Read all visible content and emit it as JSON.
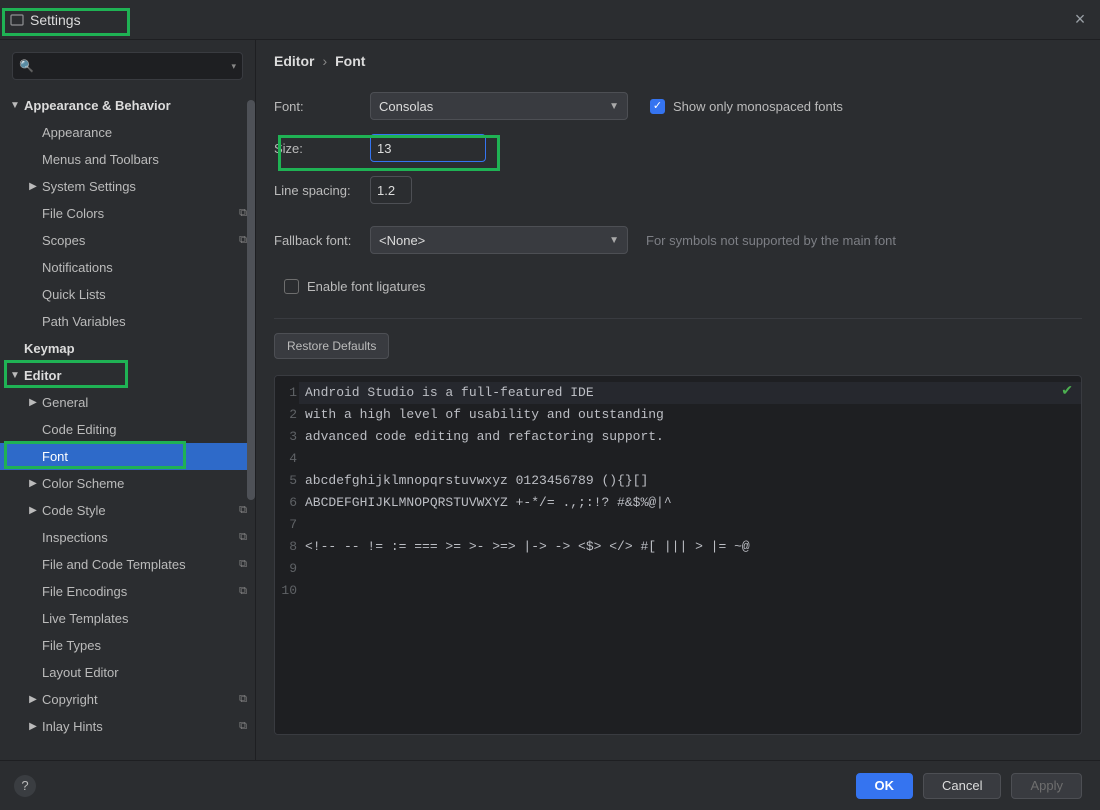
{
  "window": {
    "title": "Settings"
  },
  "search": {
    "placeholder": ""
  },
  "sidebar": {
    "items": [
      {
        "label": "Appearance & Behavior",
        "depth": 0,
        "bold": true,
        "arrow": "▼"
      },
      {
        "label": "Appearance",
        "depth": 1
      },
      {
        "label": "Menus and Toolbars",
        "depth": 1
      },
      {
        "label": "System Settings",
        "depth": 1,
        "arrow": "▶"
      },
      {
        "label": "File Colors",
        "depth": 1,
        "copy": true
      },
      {
        "label": "Scopes",
        "depth": 1,
        "copy": true
      },
      {
        "label": "Notifications",
        "depth": 1
      },
      {
        "label": "Quick Lists",
        "depth": 1
      },
      {
        "label": "Path Variables",
        "depth": 1
      },
      {
        "label": "Keymap",
        "depth": 0,
        "bold": true
      },
      {
        "label": "Editor",
        "depth": 0,
        "bold": true,
        "arrow": "▼"
      },
      {
        "label": "General",
        "depth": 1,
        "arrow": "▶"
      },
      {
        "label": "Code Editing",
        "depth": 1
      },
      {
        "label": "Font",
        "depth": 1,
        "selected": true
      },
      {
        "label": "Color Scheme",
        "depth": 1,
        "arrow": "▶"
      },
      {
        "label": "Code Style",
        "depth": 1,
        "arrow": "▶",
        "copy": true
      },
      {
        "label": "Inspections",
        "depth": 1,
        "copy": true
      },
      {
        "label": "File and Code Templates",
        "depth": 1,
        "copy": true
      },
      {
        "label": "File Encodings",
        "depth": 1,
        "copy": true
      },
      {
        "label": "Live Templates",
        "depth": 1
      },
      {
        "label": "File Types",
        "depth": 1
      },
      {
        "label": "Layout Editor",
        "depth": 1
      },
      {
        "label": "Copyright",
        "depth": 1,
        "arrow": "▶",
        "copy": true
      },
      {
        "label": "Inlay Hints",
        "depth": 1,
        "arrow": "▶",
        "copy": true
      }
    ]
  },
  "breadcrumb": {
    "parent": "Editor",
    "current": "Font"
  },
  "form": {
    "font_label": "Font:",
    "font_value": "Consolas",
    "show_monospaced_label": "Show only monospaced fonts",
    "show_monospaced_checked": true,
    "size_label": "Size:",
    "size_value": "13",
    "line_spacing_label": "Line spacing:",
    "line_spacing_value": "1.2",
    "fallback_label": "Fallback font:",
    "fallback_value": "<None>",
    "fallback_hint": "For symbols not supported by the main font",
    "ligatures_label": "Enable font ligatures",
    "ligatures_checked": false,
    "restore_label": "Restore Defaults"
  },
  "preview": {
    "lines": [
      "Android Studio is a full-featured IDE",
      "with a high level of usability and outstanding",
      "advanced code editing and refactoring support.",
      "",
      "abcdefghijklmnopqrstuvwxyz 0123456789 (){}[]",
      "ABCDEFGHIJKLMNOPQRSTUVWXYZ +-*/= .,;:!? #&$%@|^",
      "",
      "<!-- -- != := === >= >- >=> |-> -> <$> </> #[ ||| > |= ~@",
      "",
      ""
    ]
  },
  "footer": {
    "ok": "OK",
    "cancel": "Cancel",
    "apply": "Apply"
  }
}
